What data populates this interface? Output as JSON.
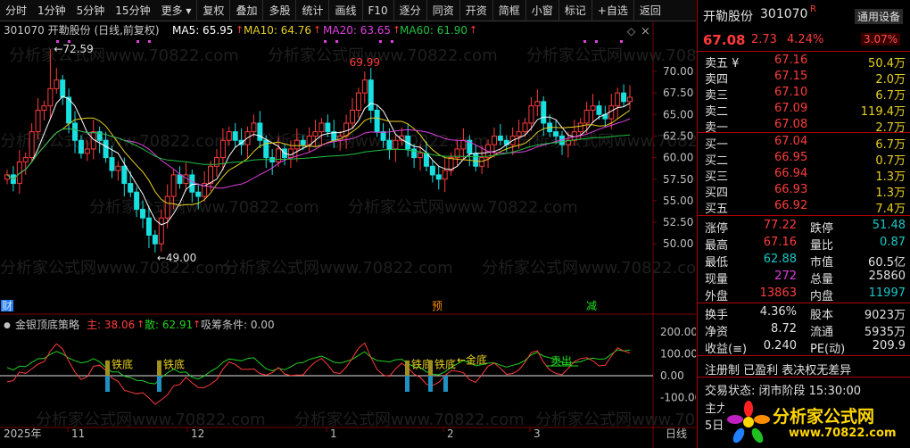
{
  "toolbar": {
    "items": [
      "分时",
      "1分钟",
      "5分钟",
      "15分钟",
      "更多",
      "复权",
      "叠加",
      "多股",
      "统计",
      "画线",
      "F10",
      "逐分",
      "同资",
      "开资",
      "简框",
      "小窗",
      "标记",
      "+自选",
      "返回"
    ]
  },
  "main_chart": {
    "title": "301070 开勒股份 (日线,前复权)",
    "ma": [
      {
        "label": "MA5: 65.95",
        "color": "#ffffff"
      },
      {
        "label": "MA10: 64.76",
        "color": "#e8d020"
      },
      {
        "label": "MA20: 63.65",
        "color": "#e040e0"
      },
      {
        "label": "MA60: 61.90",
        "color": "#20c040"
      }
    ],
    "price_ticks": [
      "70.00",
      "67.50",
      "65.00",
      "62.50",
      "60.00",
      "57.50",
      "55.00",
      "52.50",
      "50.00"
    ],
    "high_label": "72.59",
    "low_label": "49.00",
    "peak_label": "69.99",
    "markers": [
      "财",
      "预",
      "减"
    ],
    "watermark": "分析家公式网www.70822.com"
  },
  "sub_chart": {
    "title": "金银顶底策略",
    "items": [
      {
        "label": "主: 38.06",
        "color": "#ff3b3b"
      },
      {
        "label": "散: 62.91",
        "color": "#20d020"
      },
      {
        "label": "吸筹条件: 0.00",
        "color": "#c0c0c0"
      }
    ],
    "ticks": [
      "200.00",
      "100.00",
      "0.00",
      "-100.00"
    ],
    "annotations": [
      "铁底",
      "铁底",
      "铁底",
      "铁底",
      "金底",
      "卖出"
    ]
  },
  "time_axis": [
    "2025年",
    "11",
    "12",
    "1",
    "2",
    "3",
    "日线"
  ],
  "quote": {
    "name": "开勒股份",
    "code": "301070",
    "badge": "R",
    "settings": "通用设备",
    "price": "67.08",
    "change": "2.73",
    "change_pct": "4.24%",
    "turnover_badge": "3.07%",
    "asks": [
      {
        "label": "卖五 ¥",
        "price": "67.16",
        "vol": "50.4万"
      },
      {
        "label": "卖四",
        "price": "67.15",
        "vol": "2.0万"
      },
      {
        "label": "卖三",
        "price": "67.10",
        "vol": "6.7万"
      },
      {
        "label": "卖二",
        "price": "67.09",
        "vol": "119.4万"
      },
      {
        "label": "卖一",
        "price": "67.08",
        "vol": "2.7万"
      }
    ],
    "bids": [
      {
        "label": "买一",
        "price": "67.04",
        "vol": "6.7万"
      },
      {
        "label": "买二",
        "price": "66.95",
        "vol": "0.7万"
      },
      {
        "label": "买三",
        "price": "66.94",
        "vol": "1.3万"
      },
      {
        "label": "买四",
        "price": "66.93",
        "vol": "1.3万"
      },
      {
        "label": "买五",
        "price": "66.92",
        "vol": "7.4万"
      }
    ],
    "stats1": [
      {
        "l1": "涨停",
        "v1": "77.22",
        "c1": "red",
        "l2": "跌停",
        "v2": "51.48",
        "c2": "green"
      },
      {
        "l1": "最高",
        "v1": "67.16",
        "c1": "red",
        "l2": "量比",
        "v2": "0.87",
        "c2": "green"
      },
      {
        "l1": "最低",
        "v1": "62.88",
        "c1": "green",
        "l2": "市值",
        "v2": "60.5亿",
        "c2": "white"
      },
      {
        "l1": "现量",
        "v1": "272",
        "c1": "mag",
        "l2": "总量",
        "v2": "25860",
        "c2": "white"
      },
      {
        "l1": "外盘",
        "v1": "13863",
        "c1": "red",
        "l2": "内盘",
        "v2": "11997",
        "c2": "green"
      }
    ],
    "stats2": [
      {
        "l1": "换手",
        "v1": "4.36%",
        "l2": "股本",
        "v2": "9023万"
      },
      {
        "l1": "净资",
        "v1": "8.72",
        "l2": "流通",
        "v2": "5935万"
      },
      {
        "l1": "收益(≡)",
        "v1": "0.240",
        "l2": "PE(动)",
        "v2": "209.9"
      }
    ],
    "reg_line": "注册制 已盈利 表决权无差异",
    "status_line": "交易状态: 闭市阶段 15:30:00",
    "footer_a": "主力",
    "footer_b": "5日",
    "logo_text": "分析家公式网",
    "logo_url": "www.70822.com"
  }
}
